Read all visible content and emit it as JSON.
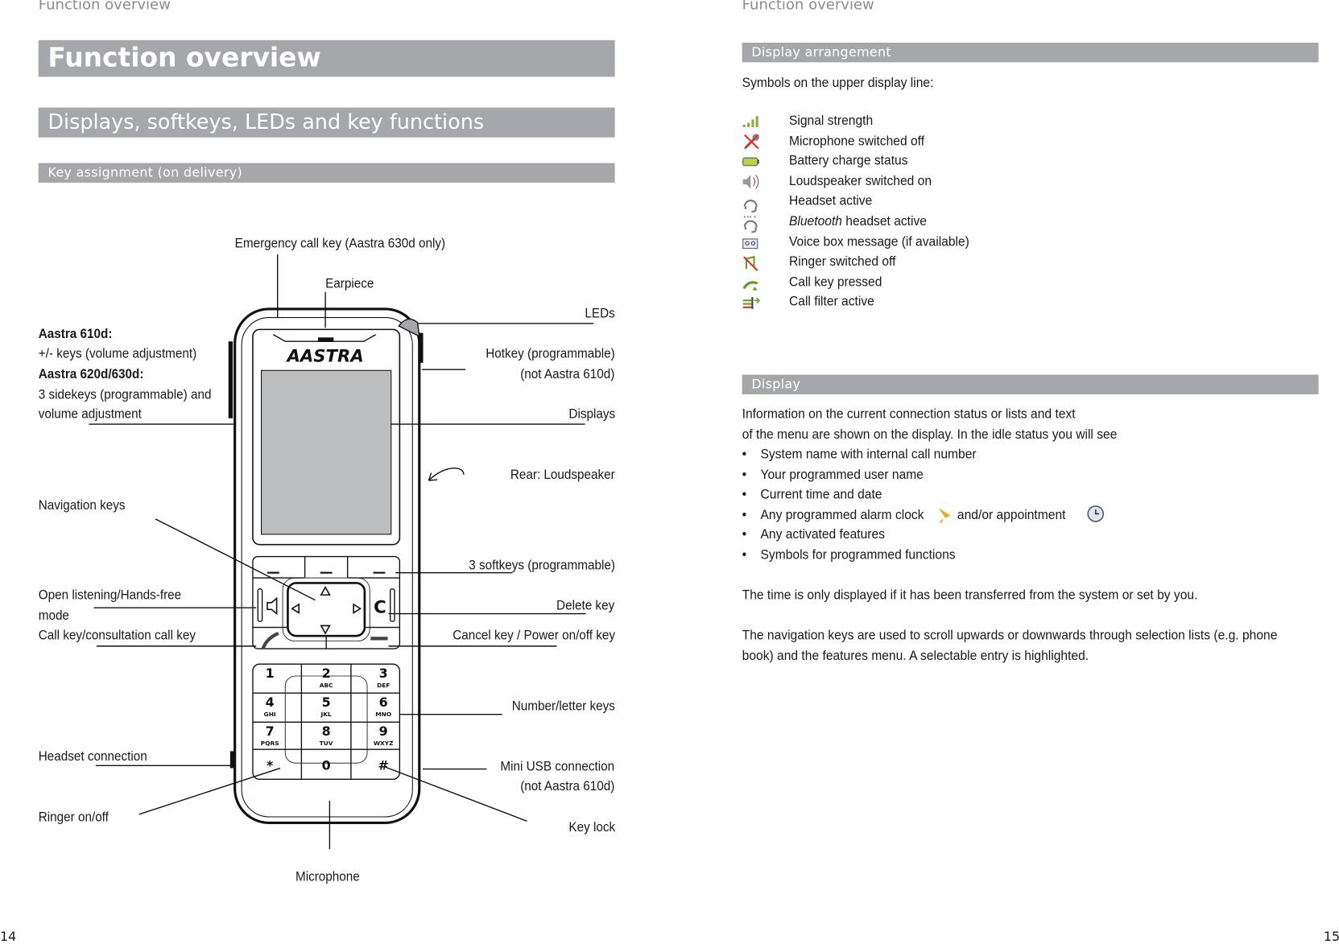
{
  "left_page": {
    "running_header": "Function overview",
    "title": "Function overview",
    "section": "Displays, softkeys, LEDs and key functions",
    "subsection": "Key assignment (on delivery)",
    "page_number": "14",
    "phone_brand": "AASTRA",
    "keypad": [
      [
        "1",
        ""
      ],
      [
        "2",
        "ABC"
      ],
      [
        "3",
        "DEF"
      ],
      [
        "4",
        "GHI"
      ],
      [
        "5",
        "JKL"
      ],
      [
        "6",
        "MNO"
      ],
      [
        "7",
        "PQRS"
      ],
      [
        "8",
        "TUV"
      ],
      [
        "9",
        "WXYZ"
      ],
      [
        "*",
        ""
      ],
      [
        "0",
        ""
      ],
      [
        "#",
        ""
      ]
    ],
    "callouts": {
      "emergency": "Emergency call key (Aastra 630d only)",
      "earpiece": "Earpiece",
      "leds": "LEDs",
      "model610": "Aastra 610d:",
      "model610_desc": "+/- keys (volume adjustment)",
      "model620": "Aastra 620d/630d:",
      "model620_desc1": "3 sidekeys (programmable) and",
      "model620_desc2": "volume adjustment",
      "hotkey1": "Hotkey (programmable)",
      "hotkey2": "(not Aastra 610d)",
      "displays": "Displays",
      "rear_loudspeaker": "Rear: Loudspeaker",
      "navigation": "Navigation keys",
      "softkeys": "3 softkeys (programmable)",
      "open_listening1": "Open listening/Hands-free",
      "open_listening2": "mode",
      "delete": "Delete key",
      "call_key": "Call key/consultation call key",
      "cancel": "Cancel key / Power on/off key",
      "number_keys": "Number/letter keys",
      "headset": "Headset connection",
      "usb1": "Mini USB connection",
      "usb2": "(not Aastra 610d)",
      "ringer": "Ringer on/off",
      "keylock": "Key lock",
      "microphone": "Microphone"
    }
  },
  "right_page": {
    "running_header": "Function overview",
    "page_number": "15",
    "display_arrangement": {
      "heading": "Display arrangement",
      "intro": "Symbols on the upper display line:",
      "symbols": [
        {
          "icon": "signal-strength",
          "label": "Signal strength"
        },
        {
          "icon": "microphone-off",
          "label": "Microphone switched off"
        },
        {
          "icon": "battery",
          "label": "Battery charge status"
        },
        {
          "icon": "loudspeaker",
          "label": "Loudspeaker switched on"
        },
        {
          "icon": "headset",
          "label": "Headset active"
        },
        {
          "icon": "bluetooth-headset",
          "label_italic": "Bluetooth",
          "label": " headset active"
        },
        {
          "icon": "voicebox",
          "label": "Voice box message (if available)"
        },
        {
          "icon": "ringer-off",
          "label": "Ringer switched off"
        },
        {
          "icon": "call-key",
          "label": "Call key pressed"
        },
        {
          "icon": "call-filter",
          "label": "Call filter active"
        }
      ]
    },
    "display": {
      "heading": "Display",
      "para1_line1": "Information on the current connection status or lists and text",
      "para1_line2": "of the menu are shown on the display. In the idle status you will see",
      "bullets": [
        "System name with internal call number",
        "Your programmed user name",
        "Current time and date",
        "Any programmed alarm clock",
        "and/or appointment",
        "Any activated features",
        "Symbols for programmed functions"
      ],
      "para2": "The time is only displayed if it has been transferred from the system or set by you.",
      "para3_line1": "The navigation keys are used to scroll upwards or downwards through selection lists (e.g. phone",
      "para3_line2": "book) and the features menu. A selectable entry is highlighted."
    }
  },
  "colors": {
    "bar": "#a5a7aa",
    "running_header": "#8a8c8f",
    "icon_green": "#8bb33a",
    "icon_red": "#d9322b"
  }
}
